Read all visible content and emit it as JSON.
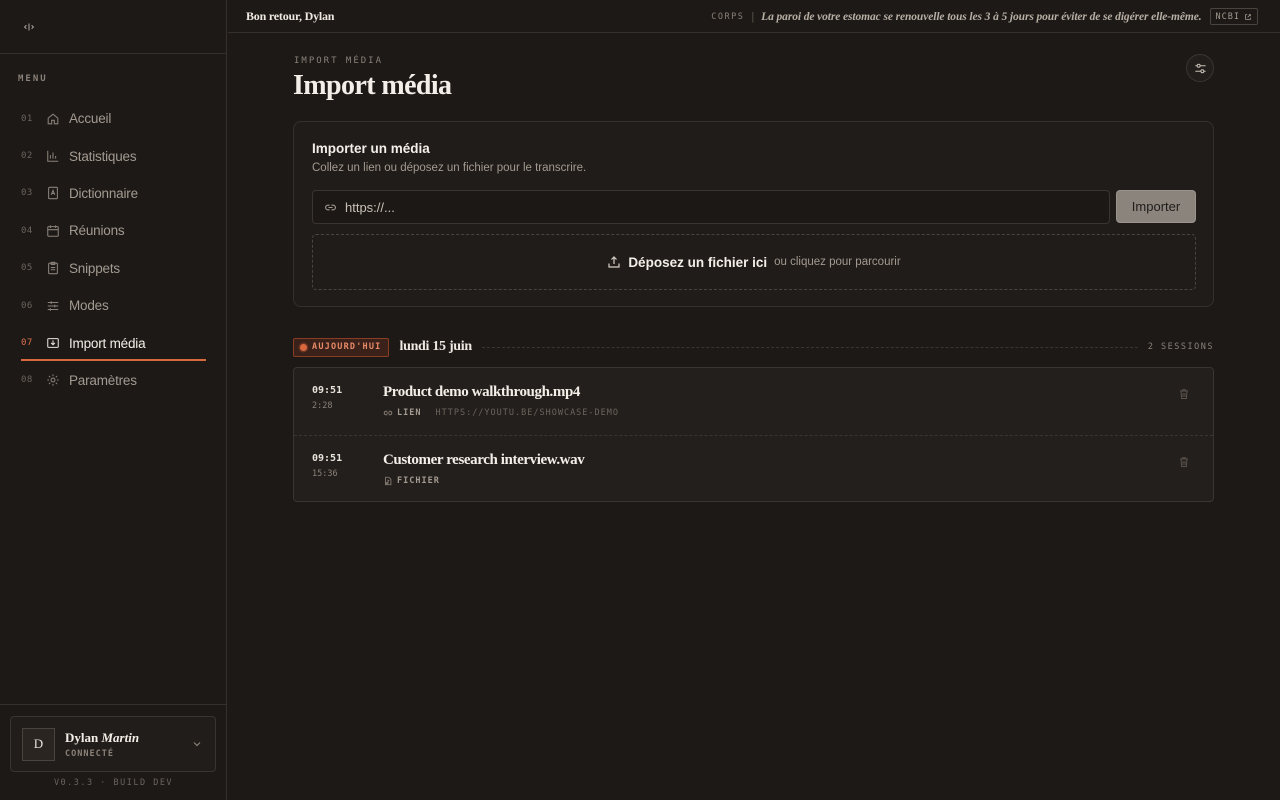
{
  "sidebar": {
    "menu_label": "MENU",
    "items": [
      {
        "num": "01",
        "label": "Accueil"
      },
      {
        "num": "02",
        "label": "Statistiques"
      },
      {
        "num": "03",
        "label": "Dictionnaire"
      },
      {
        "num": "04",
        "label": "Réunions"
      },
      {
        "num": "05",
        "label": "Snippets"
      },
      {
        "num": "06",
        "label": "Modes"
      },
      {
        "num": "07",
        "label": "Import média"
      },
      {
        "num": "08",
        "label": "Paramètres"
      }
    ],
    "user": {
      "initial": "D",
      "first_name": "Dylan",
      "last_name": "Martin",
      "status": "CONNECTÉ"
    },
    "version": "V0.3.3 · BUILD DEV"
  },
  "topbar": {
    "welcome": "Bon retour, Dylan",
    "fact_tag": "CORPS",
    "fact_sep": "|",
    "fact_text": "La paroi de votre estomac se renouvelle tous les 3 à 5 jours pour éviter de se digérer elle-même.",
    "source": "NCBI"
  },
  "main": {
    "eyebrow": "IMPORT MÉDIA",
    "title": "Import média",
    "card": {
      "title": "Importer un média",
      "subtitle": "Collez un lien ou déposez un fichier pour le transcrire.",
      "url_placeholder": "https://...",
      "import_label": "Importer",
      "drop_main": "Déposez un fichier ici",
      "drop_sub": "ou cliquez pour parcourir"
    },
    "day": {
      "badge": "AUJOURD'HUI",
      "date": "lundi 15 juin",
      "count": "2 SESSIONS"
    },
    "sessions": [
      {
        "time": "09:51",
        "duration": "2:28",
        "title": "Product demo walkthrough.mp4",
        "type": "LIEN",
        "url": "HTTPS://YOUTU.BE/SHOWCASE-DEMO"
      },
      {
        "time": "09:51",
        "duration": "15:36",
        "title": "Customer research interview.wav",
        "type": "FICHIER",
        "url": ""
      }
    ]
  },
  "colors": {
    "accent": "#d9683f",
    "background": "#1c1917"
  }
}
